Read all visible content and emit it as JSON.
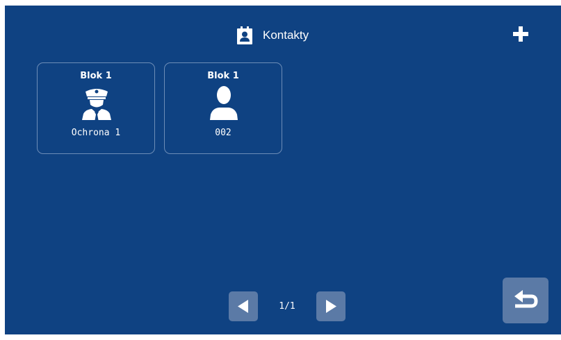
{
  "header": {
    "title": "Kontakty",
    "title_icon": "contact-book-icon",
    "add_icon": "plus-icon"
  },
  "contacts": [
    {
      "group": "Blok 1",
      "name": "Ochrona 1",
      "icon": "security-guard-icon"
    },
    {
      "group": "Blok 1",
      "name": "002",
      "icon": "person-icon"
    }
  ],
  "pagination": {
    "indicator": "1/1",
    "prev_icon": "triangle-left-icon",
    "next_icon": "triangle-right-icon"
  },
  "footer": {
    "back_icon": "return-arrow-icon"
  },
  "colors": {
    "background": "#0f4282",
    "card_border": "#6d8db7",
    "button": "#5b7aa6",
    "foreground": "#ffffff"
  }
}
